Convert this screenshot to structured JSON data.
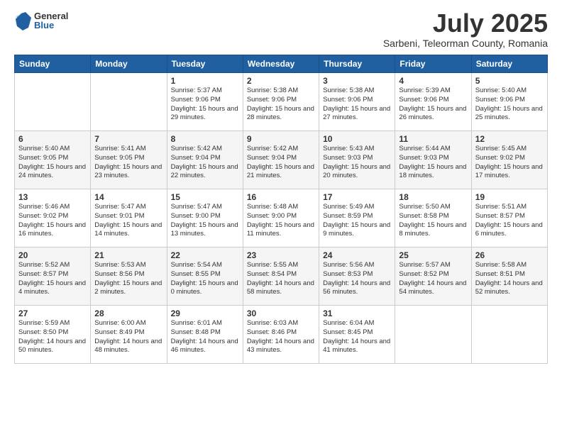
{
  "logo": {
    "general": "General",
    "blue": "Blue"
  },
  "header": {
    "month": "July 2025",
    "location": "Sarbeni, Teleorman County, Romania"
  },
  "days_of_week": [
    "Sunday",
    "Monday",
    "Tuesday",
    "Wednesday",
    "Thursday",
    "Friday",
    "Saturday"
  ],
  "weeks": [
    [
      {
        "day": "",
        "sunrise": "",
        "sunset": "",
        "daylight": ""
      },
      {
        "day": "",
        "sunrise": "",
        "sunset": "",
        "daylight": ""
      },
      {
        "day": "1",
        "sunrise": "Sunrise: 5:37 AM",
        "sunset": "Sunset: 9:06 PM",
        "daylight": "Daylight: 15 hours and 29 minutes."
      },
      {
        "day": "2",
        "sunrise": "Sunrise: 5:38 AM",
        "sunset": "Sunset: 9:06 PM",
        "daylight": "Daylight: 15 hours and 28 minutes."
      },
      {
        "day": "3",
        "sunrise": "Sunrise: 5:38 AM",
        "sunset": "Sunset: 9:06 PM",
        "daylight": "Daylight: 15 hours and 27 minutes."
      },
      {
        "day": "4",
        "sunrise": "Sunrise: 5:39 AM",
        "sunset": "Sunset: 9:06 PM",
        "daylight": "Daylight: 15 hours and 26 minutes."
      },
      {
        "day": "5",
        "sunrise": "Sunrise: 5:40 AM",
        "sunset": "Sunset: 9:06 PM",
        "daylight": "Daylight: 15 hours and 25 minutes."
      }
    ],
    [
      {
        "day": "6",
        "sunrise": "Sunrise: 5:40 AM",
        "sunset": "Sunset: 9:05 PM",
        "daylight": "Daylight: 15 hours and 24 minutes."
      },
      {
        "day": "7",
        "sunrise": "Sunrise: 5:41 AM",
        "sunset": "Sunset: 9:05 PM",
        "daylight": "Daylight: 15 hours and 23 minutes."
      },
      {
        "day": "8",
        "sunrise": "Sunrise: 5:42 AM",
        "sunset": "Sunset: 9:04 PM",
        "daylight": "Daylight: 15 hours and 22 minutes."
      },
      {
        "day": "9",
        "sunrise": "Sunrise: 5:42 AM",
        "sunset": "Sunset: 9:04 PM",
        "daylight": "Daylight: 15 hours and 21 minutes."
      },
      {
        "day": "10",
        "sunrise": "Sunrise: 5:43 AM",
        "sunset": "Sunset: 9:03 PM",
        "daylight": "Daylight: 15 hours and 20 minutes."
      },
      {
        "day": "11",
        "sunrise": "Sunrise: 5:44 AM",
        "sunset": "Sunset: 9:03 PM",
        "daylight": "Daylight: 15 hours and 18 minutes."
      },
      {
        "day": "12",
        "sunrise": "Sunrise: 5:45 AM",
        "sunset": "Sunset: 9:02 PM",
        "daylight": "Daylight: 15 hours and 17 minutes."
      }
    ],
    [
      {
        "day": "13",
        "sunrise": "Sunrise: 5:46 AM",
        "sunset": "Sunset: 9:02 PM",
        "daylight": "Daylight: 15 hours and 16 minutes."
      },
      {
        "day": "14",
        "sunrise": "Sunrise: 5:47 AM",
        "sunset": "Sunset: 9:01 PM",
        "daylight": "Daylight: 15 hours and 14 minutes."
      },
      {
        "day": "15",
        "sunrise": "Sunrise: 5:47 AM",
        "sunset": "Sunset: 9:00 PM",
        "daylight": "Daylight: 15 hours and 13 minutes."
      },
      {
        "day": "16",
        "sunrise": "Sunrise: 5:48 AM",
        "sunset": "Sunset: 9:00 PM",
        "daylight": "Daylight: 15 hours and 11 minutes."
      },
      {
        "day": "17",
        "sunrise": "Sunrise: 5:49 AM",
        "sunset": "Sunset: 8:59 PM",
        "daylight": "Daylight: 15 hours and 9 minutes."
      },
      {
        "day": "18",
        "sunrise": "Sunrise: 5:50 AM",
        "sunset": "Sunset: 8:58 PM",
        "daylight": "Daylight: 15 hours and 8 minutes."
      },
      {
        "day": "19",
        "sunrise": "Sunrise: 5:51 AM",
        "sunset": "Sunset: 8:57 PM",
        "daylight": "Daylight: 15 hours and 6 minutes."
      }
    ],
    [
      {
        "day": "20",
        "sunrise": "Sunrise: 5:52 AM",
        "sunset": "Sunset: 8:57 PM",
        "daylight": "Daylight: 15 hours and 4 minutes."
      },
      {
        "day": "21",
        "sunrise": "Sunrise: 5:53 AM",
        "sunset": "Sunset: 8:56 PM",
        "daylight": "Daylight: 15 hours and 2 minutes."
      },
      {
        "day": "22",
        "sunrise": "Sunrise: 5:54 AM",
        "sunset": "Sunset: 8:55 PM",
        "daylight": "Daylight: 15 hours and 0 minutes."
      },
      {
        "day": "23",
        "sunrise": "Sunrise: 5:55 AM",
        "sunset": "Sunset: 8:54 PM",
        "daylight": "Daylight: 14 hours and 58 minutes."
      },
      {
        "day": "24",
        "sunrise": "Sunrise: 5:56 AM",
        "sunset": "Sunset: 8:53 PM",
        "daylight": "Daylight: 14 hours and 56 minutes."
      },
      {
        "day": "25",
        "sunrise": "Sunrise: 5:57 AM",
        "sunset": "Sunset: 8:52 PM",
        "daylight": "Daylight: 14 hours and 54 minutes."
      },
      {
        "day": "26",
        "sunrise": "Sunrise: 5:58 AM",
        "sunset": "Sunset: 8:51 PM",
        "daylight": "Daylight: 14 hours and 52 minutes."
      }
    ],
    [
      {
        "day": "27",
        "sunrise": "Sunrise: 5:59 AM",
        "sunset": "Sunset: 8:50 PM",
        "daylight": "Daylight: 14 hours and 50 minutes."
      },
      {
        "day": "28",
        "sunrise": "Sunrise: 6:00 AM",
        "sunset": "Sunset: 8:49 PM",
        "daylight": "Daylight: 14 hours and 48 minutes."
      },
      {
        "day": "29",
        "sunrise": "Sunrise: 6:01 AM",
        "sunset": "Sunset: 8:48 PM",
        "daylight": "Daylight: 14 hours and 46 minutes."
      },
      {
        "day": "30",
        "sunrise": "Sunrise: 6:03 AM",
        "sunset": "Sunset: 8:46 PM",
        "daylight": "Daylight: 14 hours and 43 minutes."
      },
      {
        "day": "31",
        "sunrise": "Sunrise: 6:04 AM",
        "sunset": "Sunset: 8:45 PM",
        "daylight": "Daylight: 14 hours and 41 minutes."
      },
      {
        "day": "",
        "sunrise": "",
        "sunset": "",
        "daylight": ""
      },
      {
        "day": "",
        "sunrise": "",
        "sunset": "",
        "daylight": ""
      }
    ]
  ]
}
